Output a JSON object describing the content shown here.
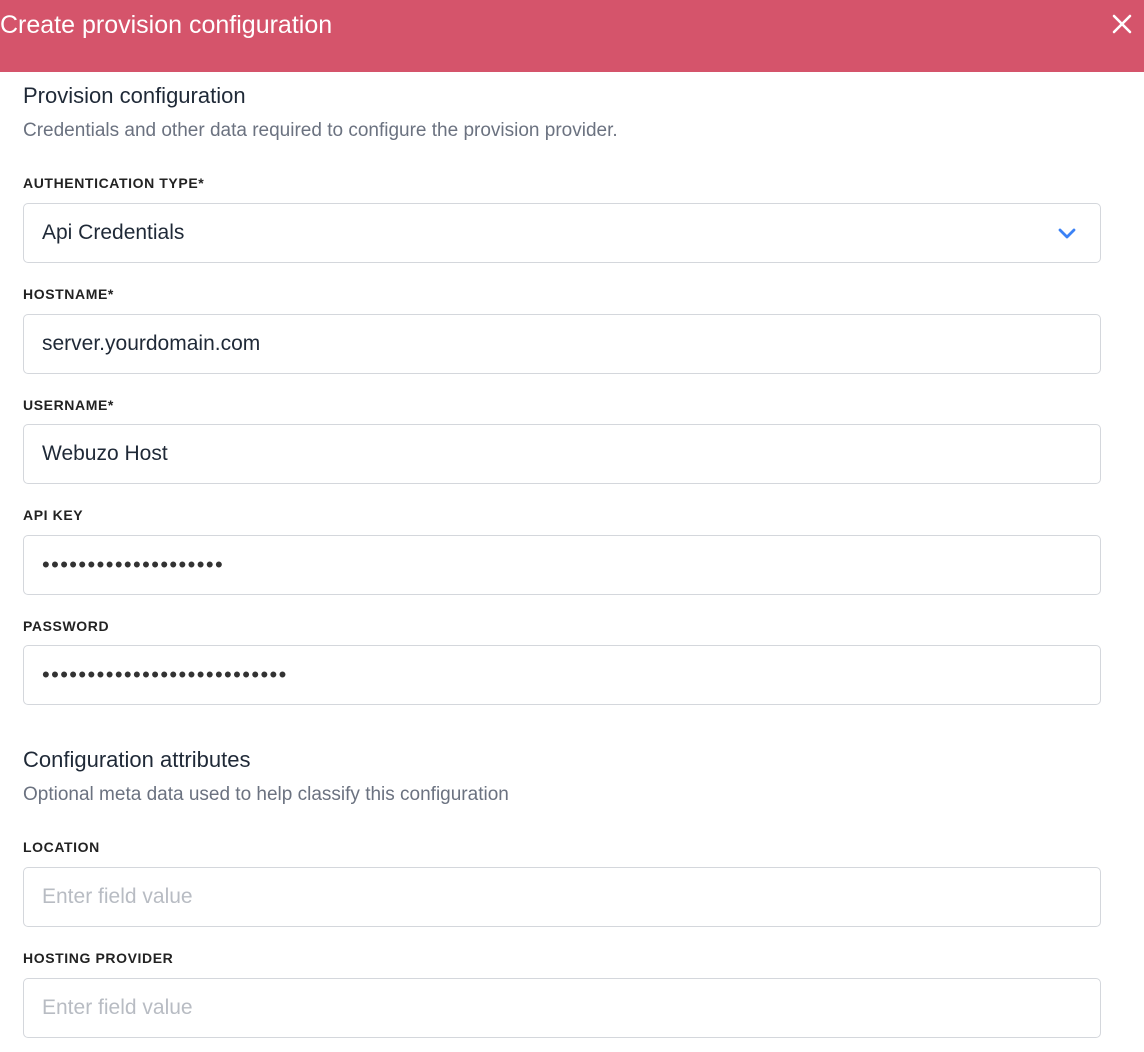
{
  "header": {
    "title": "Create provision configuration",
    "close_icon": "close-icon"
  },
  "provision": {
    "title": "Provision configuration",
    "description": "Credentials and other data required to configure the provision provider."
  },
  "fields": {
    "auth_type": {
      "label": "AUTHENTICATION TYPE*",
      "value": "Api Credentials",
      "icon": "chevron-down-icon",
      "icon_color": "#3b82f6"
    },
    "hostname": {
      "label": "HOSTNAME*",
      "value": "server.yourdomain.com"
    },
    "username": {
      "label": "USERNAME*",
      "value": "Webuzo Host"
    },
    "api_key": {
      "label": "API KEY",
      "masked": "••••••••••••••••••••"
    },
    "password": {
      "label": "PASSWORD",
      "masked": "•••••••••••••••••••••••••••"
    }
  },
  "attributes": {
    "title": "Configuration attributes",
    "description": "Optional meta data used to help classify this configuration",
    "location": {
      "label": "LOCATION",
      "placeholder": "Enter field value",
      "value": ""
    },
    "hosting_provider": {
      "label": "HOSTING PROVIDER",
      "placeholder": "Enter field value",
      "value": ""
    }
  },
  "colors": {
    "header_bg": "#d5546b",
    "accent": "#3b82f6",
    "border": "#d4d7dc"
  }
}
